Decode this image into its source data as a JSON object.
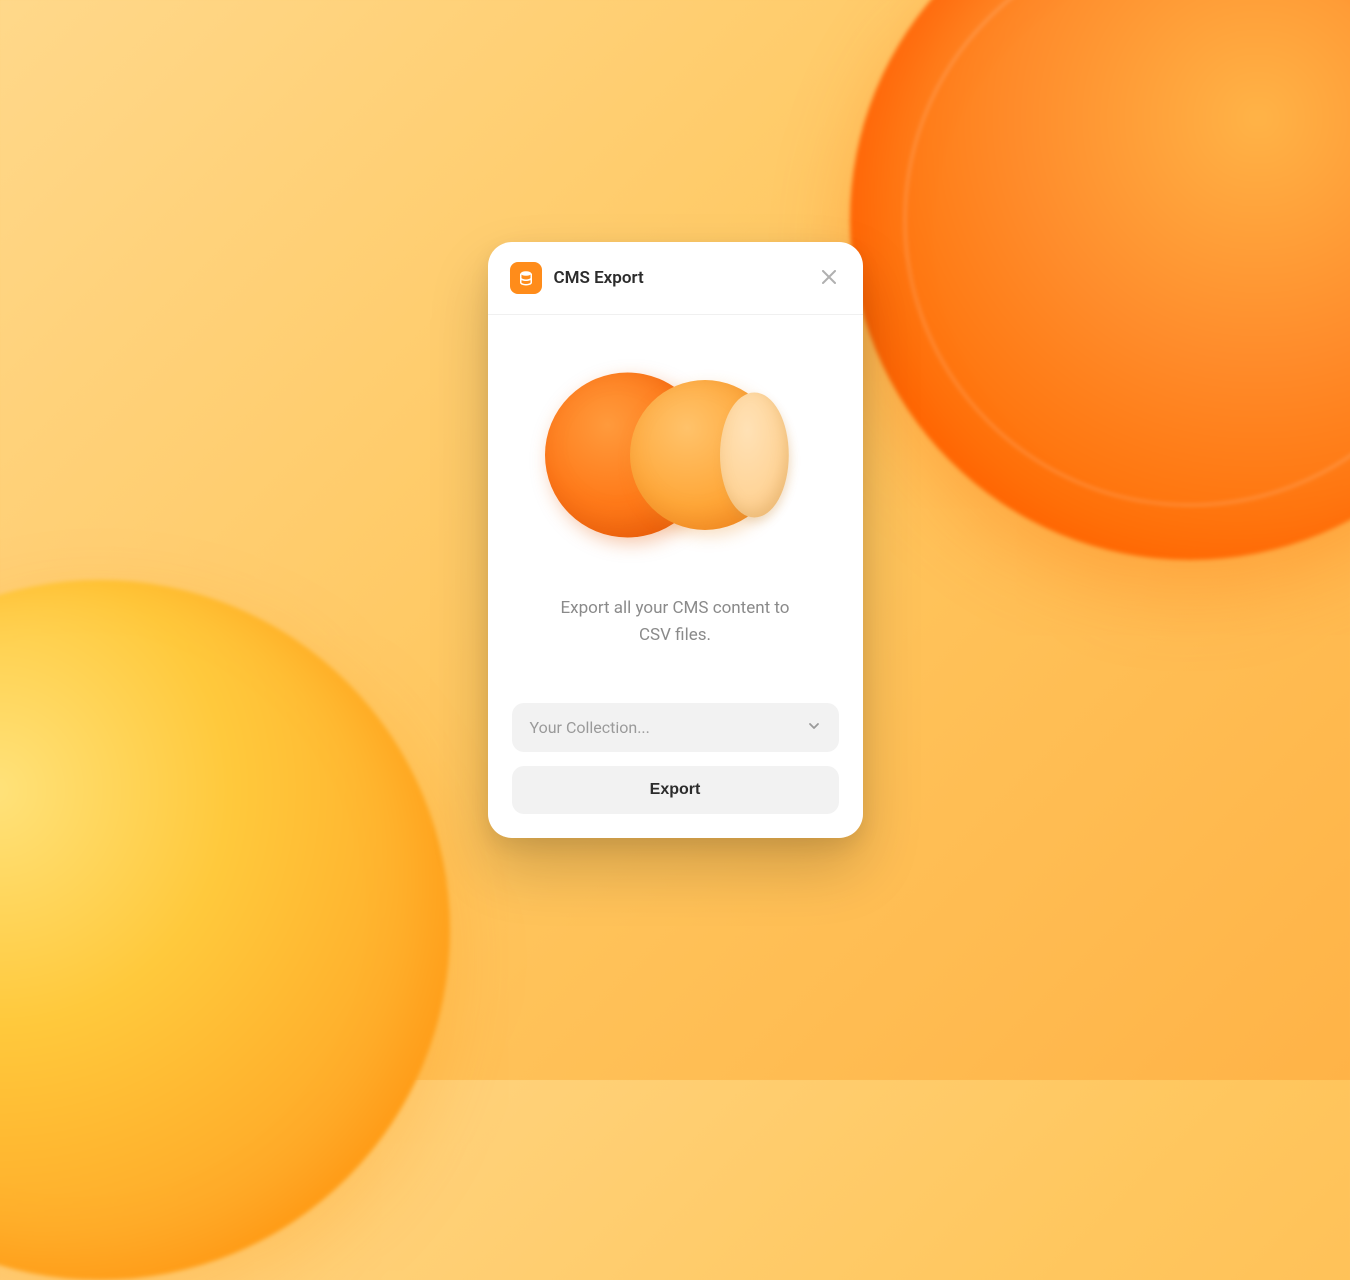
{
  "card": {
    "title": "CMS Export",
    "description": "Export all your CMS content to CSV files.",
    "select_placeholder": "Your Collection...",
    "export_button_label": "Export"
  },
  "colors": {
    "accent": "#ff8c1a",
    "background_gradient_start": "#ffd88a",
    "background_gradient_end": "#ffb347"
  }
}
